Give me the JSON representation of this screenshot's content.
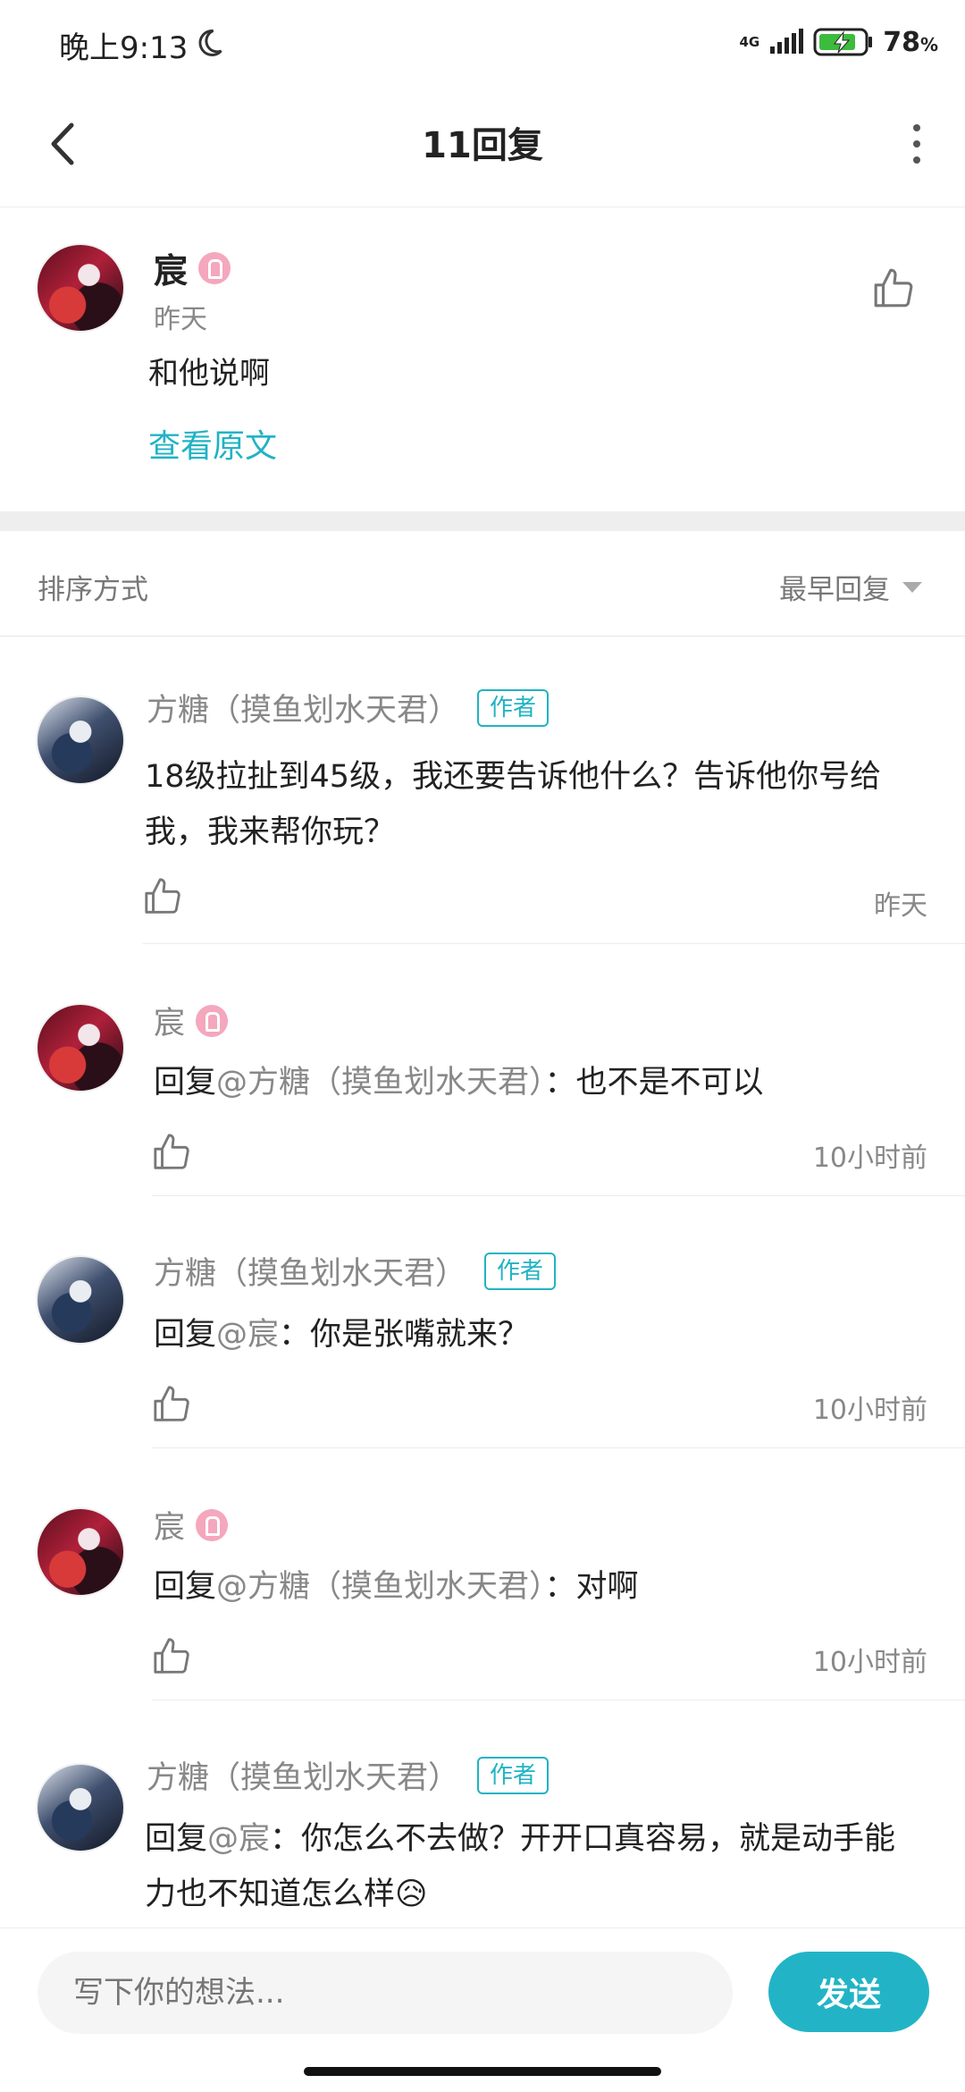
{
  "status_bar": {
    "time": "晚上9:13",
    "network": "4G",
    "battery_level": "78",
    "battery_unit": "%"
  },
  "header": {
    "title": "11回复"
  },
  "post": {
    "author": "宸",
    "time": "昨天",
    "text": "和他说啊",
    "view_original_label": "查看原文"
  },
  "sort": {
    "label": "排序方式",
    "value": "最早回复"
  },
  "replies": [
    {
      "author": "方糖（摸鱼划水天君）",
      "author_tag": "作者",
      "reply_prefix": "",
      "mention": "",
      "text": "18级拉扯到45级，我还要告诉他什么？告诉他你号给我，我来帮你玩？",
      "time": "昨天"
    },
    {
      "author": "宸",
      "reply_prefix": "回复",
      "mention": "@方糖（摸鱼划水天君）",
      "text": "：也不是不可以",
      "time": "10小时前"
    },
    {
      "author": "方糖（摸鱼划水天君）",
      "author_tag": "作者",
      "reply_prefix": "回复",
      "mention": "@宸",
      "text": "：你是张嘴就来？",
      "time": "10小时前"
    },
    {
      "author": "宸",
      "reply_prefix": "回复",
      "mention": "@方糖（摸鱼划水天君）",
      "text": "：对啊",
      "time": "10小时前"
    },
    {
      "author": "方糖（摸鱼划水天君）",
      "author_tag": "作者",
      "reply_prefix": "回复",
      "mention": "@宸",
      "text": "：你怎么不去做？开开口真容易，就是动手能力也不知道怎么样😥",
      "time": ""
    }
  ],
  "input": {
    "placeholder": "写下你的想法...",
    "send_label": "发送"
  },
  "colors": {
    "accent": "#21b3c4",
    "send_button": "#22b4c6",
    "pink_badge": "#f4a7bd"
  }
}
